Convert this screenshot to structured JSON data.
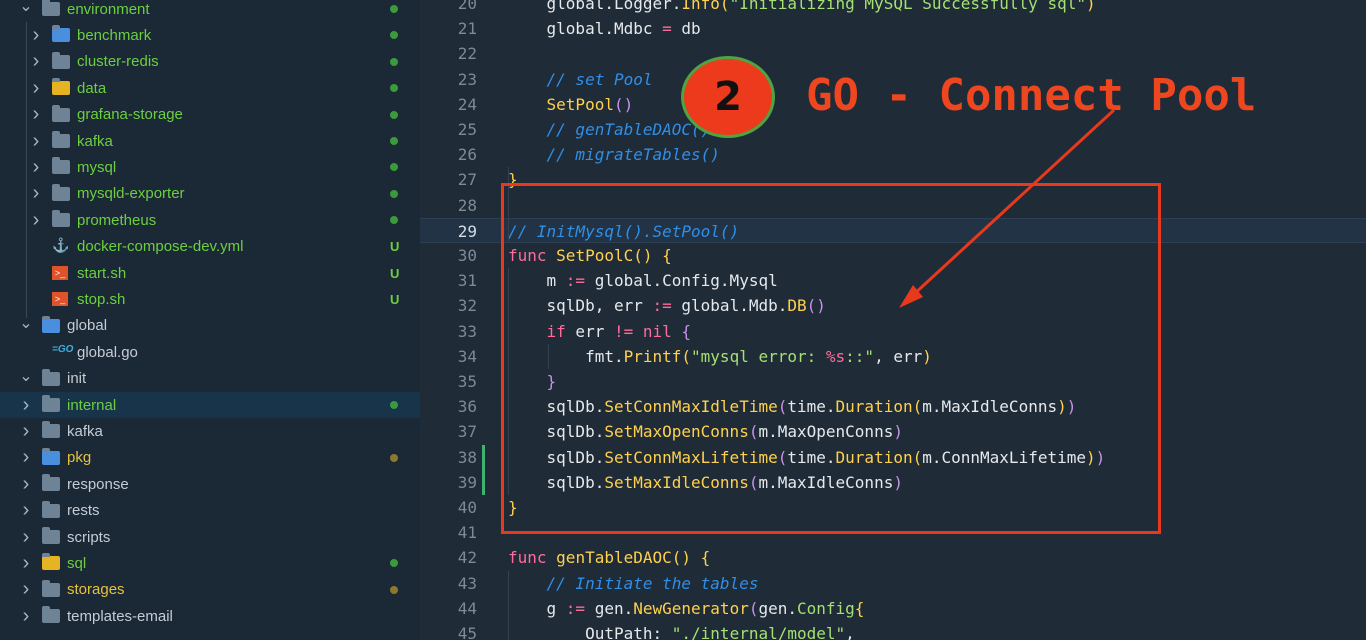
{
  "explorer": {
    "items": [
      {
        "label": "environment",
        "depth": 1,
        "chevron": "v",
        "icon": "folder",
        "color": "#6ccf3f",
        "status": "dot",
        "status_color": "#3b9a3b"
      },
      {
        "label": "benchmark",
        "depth": 2,
        "chevron": ">",
        "icon": "folder-blue",
        "color": "#6ccf3f",
        "status": "dot",
        "status_color": "#3b9a3b"
      },
      {
        "label": "cluster-redis",
        "depth": 2,
        "chevron": ">",
        "icon": "folder",
        "color": "#6ccf3f",
        "status": "dot",
        "status_color": "#3b9a3b"
      },
      {
        "label": "data",
        "depth": 2,
        "chevron": ">",
        "icon": "folder-yellow",
        "color": "#6ccf3f",
        "status": "dot",
        "status_color": "#3b9a3b"
      },
      {
        "label": "grafana-storage",
        "depth": 2,
        "chevron": ">",
        "icon": "folder",
        "color": "#6ccf3f",
        "status": "dot",
        "status_color": "#3b9a3b"
      },
      {
        "label": "kafka",
        "depth": 2,
        "chevron": ">",
        "icon": "folder",
        "color": "#6ccf3f",
        "status": "dot",
        "status_color": "#3b9a3b"
      },
      {
        "label": "mysql",
        "depth": 2,
        "chevron": ">",
        "icon": "folder",
        "color": "#6ccf3f",
        "status": "dot",
        "status_color": "#3b9a3b"
      },
      {
        "label": "mysqld-exporter",
        "depth": 2,
        "chevron": ">",
        "icon": "folder",
        "color": "#6ccf3f",
        "status": "dot",
        "status_color": "#3b9a3b"
      },
      {
        "label": "prometheus",
        "depth": 2,
        "chevron": ">",
        "icon": "folder",
        "color": "#6ccf3f",
        "status": "dot",
        "status_color": "#3b9a3b"
      },
      {
        "label": "docker-compose-dev.yml",
        "depth": 2,
        "chevron": "",
        "icon": "docker",
        "color": "#6ccf3f",
        "status": "U",
        "status_color": "#6ccf3f"
      },
      {
        "label": "start.sh",
        "depth": 2,
        "chevron": "",
        "icon": "shell",
        "color": "#6ccf3f",
        "status": "U",
        "status_color": "#6ccf3f"
      },
      {
        "label": "stop.sh",
        "depth": 2,
        "chevron": "",
        "icon": "shell",
        "color": "#6ccf3f",
        "status": "U",
        "status_color": "#6ccf3f"
      },
      {
        "label": "global",
        "depth": 1,
        "chevron": "v",
        "icon": "folder-blue",
        "color": "#c5ccd3",
        "status": "",
        "status_color": ""
      },
      {
        "label": "global.go",
        "depth": 2,
        "chevron": "",
        "icon": "go",
        "color": "#c5ccd3",
        "status": "",
        "status_color": ""
      },
      {
        "label": "init",
        "depth": 1,
        "chevron": "v",
        "icon": "folder",
        "color": "#c5ccd3",
        "status": "",
        "status_color": ""
      },
      {
        "label": "internal",
        "depth": 1,
        "chevron": ">",
        "icon": "folder",
        "color": "#6ccf3f",
        "status": "dot",
        "status_color": "#3b9a3b",
        "selected": true
      },
      {
        "label": "kafka",
        "depth": 1,
        "chevron": ">",
        "icon": "folder",
        "color": "#c5ccd3",
        "status": "",
        "status_color": ""
      },
      {
        "label": "pkg",
        "depth": 1,
        "chevron": ">",
        "icon": "folder-blue",
        "color": "#e5c33c",
        "status": "dot",
        "status_color": "#8a7a2a"
      },
      {
        "label": "response",
        "depth": 1,
        "chevron": ">",
        "icon": "folder",
        "color": "#c5ccd3",
        "status": "",
        "status_color": ""
      },
      {
        "label": "rests",
        "depth": 1,
        "chevron": ">",
        "icon": "folder",
        "color": "#c5ccd3",
        "status": "",
        "status_color": ""
      },
      {
        "label": "scripts",
        "depth": 1,
        "chevron": ">",
        "icon": "folder",
        "color": "#c5ccd3",
        "status": "",
        "status_color": ""
      },
      {
        "label": "sql",
        "depth": 1,
        "chevron": ">",
        "icon": "folder-yellow",
        "color": "#6ccf3f",
        "status": "dot",
        "status_color": "#3b9a3b"
      },
      {
        "label": "storages",
        "depth": 1,
        "chevron": ">",
        "icon": "folder",
        "color": "#e5c33c",
        "status": "dot",
        "status_color": "#8a7a2a"
      },
      {
        "label": "templates-email",
        "depth": 1,
        "chevron": ">",
        "icon": "folder",
        "color": "#c5ccd3",
        "status": "",
        "status_color": ""
      }
    ]
  },
  "editor": {
    "lines": [
      {
        "n": "20",
        "html": "    global.Logger.<span class=\"fn\">Info</span><span class=\"br2\">(</span><span class=\"str\">\"Initializing MySQL Successfully sql\"</span><span class=\"br2\">)</span>"
      },
      {
        "n": "21",
        "html": "    global.Mdbc <span class=\"op\">=</span> db"
      },
      {
        "n": "22",
        "html": ""
      },
      {
        "n": "23",
        "html": "    <span class=\"cm\">// set Pool</span>"
      },
      {
        "n": "24",
        "html": "    <span class=\"fn\">SetPool</span><span class=\"br\">()</span>"
      },
      {
        "n": "25",
        "html": "    <span class=\"cm\">// genTableDAOC()</span>"
      },
      {
        "n": "26",
        "html": "    <span class=\"cm\">// migrateTables()</span>"
      },
      {
        "n": "27",
        "html": "<span class=\"br2\">}</span>"
      },
      {
        "n": "28",
        "html": ""
      },
      {
        "n": "29",
        "html": "<span class=\"cm\">// InitMysql().SetPool()</span>",
        "hl": true
      },
      {
        "n": "30",
        "html": "<span class=\"k\">func</span> <span class=\"fn\">SetPoolC</span><span class=\"br2\">()</span> <span class=\"br2\">{</span>"
      },
      {
        "n": "31",
        "html": "    m <span class=\"op\">:=</span> global.Config.Mysql"
      },
      {
        "n": "32",
        "html": "    sqlDb, err <span class=\"op\">:=</span> global.Mdb.<span class=\"fn\">DB</span><span class=\"br\">()</span>"
      },
      {
        "n": "33",
        "html": "    <span class=\"k\">if</span> err <span class=\"op\">!=</span> <span class=\"k\">nil</span> <span class=\"br\">{</span>"
      },
      {
        "n": "34",
        "html": "        fmt.<span class=\"fn\">Printf</span><span class=\"br2\">(</span><span class=\"str\">\"mysql error: </span><span class=\"fmt\">%s</span><span class=\"str\">::\"</span>, err<span class=\"br2\">)</span>"
      },
      {
        "n": "35",
        "html": "    <span class=\"br\">}</span>"
      },
      {
        "n": "36",
        "html": "    sqlDb.<span class=\"fn\">SetConnMaxIdleTime</span><span class=\"br\">(</span>time.<span class=\"fn\">Duration</span><span class=\"br2\">(</span>m.MaxIdleConns<span class=\"br2\">)</span><span class=\"br\">)</span>"
      },
      {
        "n": "37",
        "html": "    sqlDb.<span class=\"fn\">SetMaxOpenConns</span><span class=\"br\">(</span>m.MaxOpenConns<span class=\"br\">)</span>"
      },
      {
        "n": "38",
        "html": "    sqlDb.<span class=\"fn\">SetConnMaxLifetime</span><span class=\"br\">(</span>time.<span class=\"fn\">Duration</span><span class=\"br2\">(</span>m.ConnMaxLifetime<span class=\"br2\">)</span><span class=\"br\">)</span>",
        "git": true
      },
      {
        "n": "39",
        "html": "    sqlDb.<span class=\"fn\">SetMaxIdleConns</span><span class=\"br\">(</span>m.MaxIdleConns<span class=\"br\">)</span>",
        "git": true
      },
      {
        "n": "40",
        "html": "<span class=\"br2\">}</span>"
      },
      {
        "n": "41",
        "html": ""
      },
      {
        "n": "42",
        "html": "<span class=\"k\">func</span> <span class=\"fn\">genTableDAOC</span><span class=\"br2\">()</span> <span class=\"br2\">{</span>"
      },
      {
        "n": "43",
        "html": "    <span class=\"cm\">// Initiate the tables</span>"
      },
      {
        "n": "44",
        "html": "    g <span class=\"op\">:=</span> gen.<span class=\"fn\">NewGenerator</span><span class=\"br\">(</span>gen.<span class=\"ty\">Config</span><span class=\"br2\">{</span>"
      },
      {
        "n": "45",
        "html": "        OutPath: <span class=\"str\">\"./internal/model\"</span>,"
      }
    ]
  },
  "annotation": {
    "badge": "2",
    "text": "GO - Connect Pool",
    "color": "#ee4720"
  }
}
